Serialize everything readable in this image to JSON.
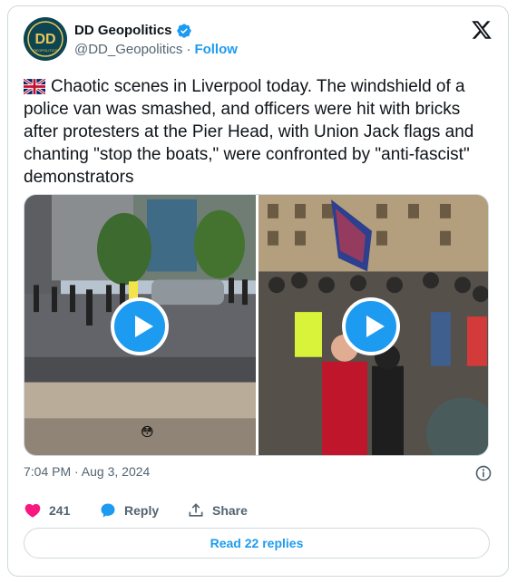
{
  "account": {
    "display_name": "DD Geopolitics",
    "handle": "@DD_Geopolitics",
    "separator": "·",
    "follow_label": "Follow",
    "avatar_text": "DD",
    "avatar_subtext": "GEOPOLITICS"
  },
  "tweet": {
    "flag_icon": "uk-flag-icon",
    "text": "Chaotic scenes in Liverpool today. The windshield of a police van was smashed, and officers were hit with bricks after protesters at the Pier Head, with Union Jack flags and chanting \"stop the boats,\" were confronted by \"anti-fascist\" demonstrators",
    "timestamp": "7:04 PM · Aug 3, 2024"
  },
  "media": {
    "videos": [
      {
        "name": "street-protest-video"
      },
      {
        "name": "pier-head-crowd-video"
      }
    ],
    "emoji": "😳"
  },
  "actions": {
    "like_count": "241",
    "reply_label": "Reply",
    "share_label": "Share"
  },
  "footer": {
    "read_replies_label": "Read 22 replies"
  },
  "colors": {
    "accent": "#1d9bf0",
    "like": "#f91880",
    "text": "#0f1419",
    "muted": "#536471",
    "border": "#cfd9de"
  }
}
